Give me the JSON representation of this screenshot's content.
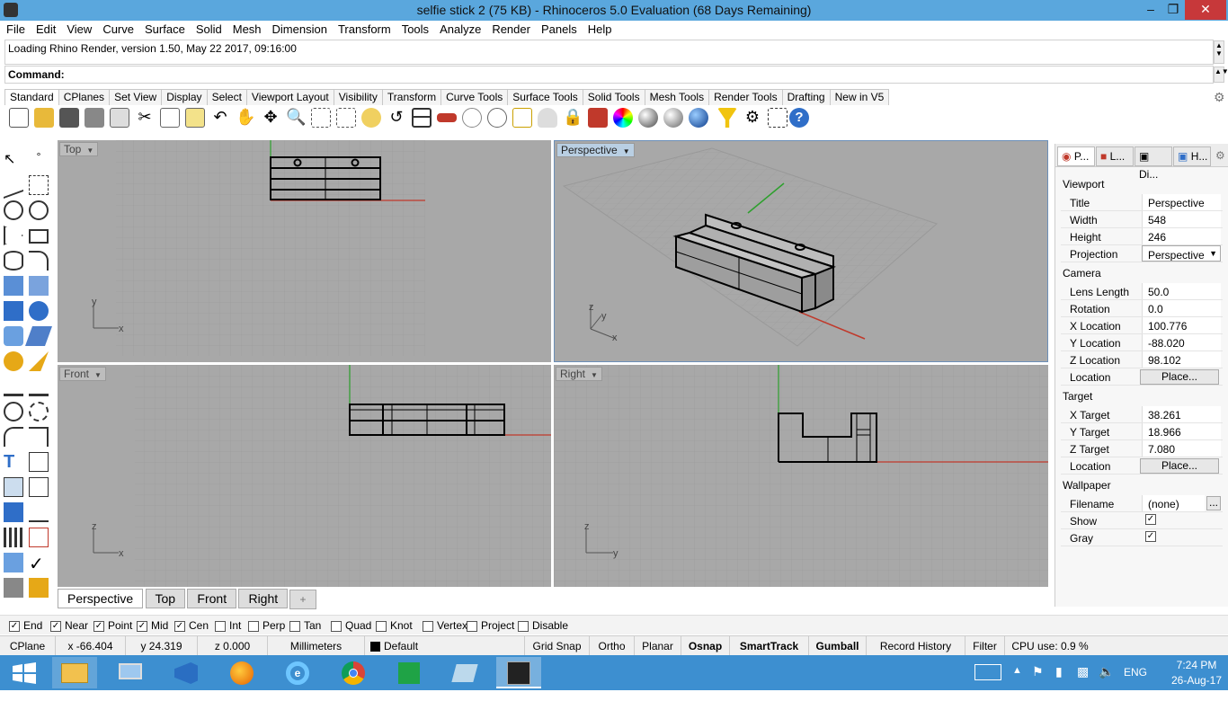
{
  "window": {
    "title": "selfie stick 2 (75 KB) - Rhinoceros 5.0 Evaluation (68 Days Remaining)"
  },
  "menu": [
    "File",
    "Edit",
    "View",
    "Curve",
    "Surface",
    "Solid",
    "Mesh",
    "Dimension",
    "Transform",
    "Tools",
    "Analyze",
    "Render",
    "Panels",
    "Help"
  ],
  "command_history": "Loading Rhino Render, version 1.50, May 22 2017, 09:16:00",
  "command_label": "Command:",
  "toolbar_tabs": [
    "Standard",
    "CPlanes",
    "Set View",
    "Display",
    "Select",
    "Viewport Layout",
    "Visibility",
    "Transform",
    "Curve Tools",
    "Surface Tools",
    "Solid Tools",
    "Mesh Tools",
    "Render Tools",
    "Drafting",
    "New in V5"
  ],
  "viewports": {
    "top": {
      "label": "Top",
      "axis1": "y",
      "axis2": "x"
    },
    "perspective": {
      "label": "Perspective",
      "axis1": "z",
      "axis2": "y",
      "axis3": "x"
    },
    "front": {
      "label": "Front",
      "axis1": "z",
      "axis2": "x"
    },
    "right": {
      "label": "Right",
      "axis1": "z",
      "axis2": "y"
    }
  },
  "viewport_tabs": [
    "Perspective",
    "Top",
    "Front",
    "Right",
    "+"
  ],
  "panel": {
    "tabs": [
      "P...",
      "L...",
      "Di...",
      "H..."
    ],
    "viewport_section": "Viewport",
    "title_label": "Title",
    "title_value": "Perspective",
    "width_label": "Width",
    "width_value": "548",
    "height_label": "Height",
    "height_value": "246",
    "projection_label": "Projection",
    "projection_value": "Perspective",
    "camera_section": "Camera",
    "lens_label": "Lens Length",
    "lens_value": "50.0",
    "rotation_label": "Rotation",
    "rotation_value": "0.0",
    "xloc_label": "X Location",
    "xloc_value": "100.776",
    "yloc_label": "Y Location",
    "yloc_value": "-88.020",
    "zloc_label": "Z Location",
    "zloc_value": "98.102",
    "location_label": "Location",
    "place_label": "Place...",
    "target_section": "Target",
    "xt_label": "X Target",
    "xt_value": "38.261",
    "yt_label": "Y Target",
    "yt_value": "18.966",
    "zt_label": "Z Target",
    "zt_value": "7.080",
    "wallpaper_section": "Wallpaper",
    "filename_label": "Filename",
    "filename_value": "(none)",
    "browse_label": "...",
    "show_label": "Show",
    "gray_label": "Gray"
  },
  "osnaps": [
    {
      "label": "End",
      "checked": true
    },
    {
      "label": "Near",
      "checked": true
    },
    {
      "label": "Point",
      "checked": true
    },
    {
      "label": "Mid",
      "checked": true
    },
    {
      "label": "Cen",
      "checked": true
    },
    {
      "label": "Int",
      "checked": false
    },
    {
      "label": "Perp",
      "checked": false
    },
    {
      "label": "Tan",
      "checked": false
    },
    {
      "label": "Quad",
      "checked": false
    },
    {
      "label": "Knot",
      "checked": false
    },
    {
      "label": "Vertex",
      "checked": false
    },
    {
      "label": "Project",
      "checked": false
    },
    {
      "label": "Disable",
      "checked": false
    }
  ],
  "status": {
    "cplane": "CPlane",
    "x": "x -66.404",
    "y": "y 24.319",
    "z": "z 0.000",
    "units": "Millimeters",
    "layer": "Default",
    "grid_snap": "Grid Snap",
    "ortho": "Ortho",
    "planar": "Planar",
    "osnap": "Osnap",
    "smarttrack": "SmartTrack",
    "gumball": "Gumball",
    "record_history": "Record History",
    "filter": "Filter",
    "cpu": "CPU use: 0.9 %"
  },
  "taskbar": {
    "language": "ENG",
    "time": "7:24 PM",
    "date": "26-Aug-17"
  },
  "colors": {
    "titlebar": "#5aa7dd",
    "taskbar": "#3d8fd0",
    "viewport_bg": "#a8a8a8",
    "x_axis": "#c0392b",
    "y_axis": "#2ea02e"
  }
}
